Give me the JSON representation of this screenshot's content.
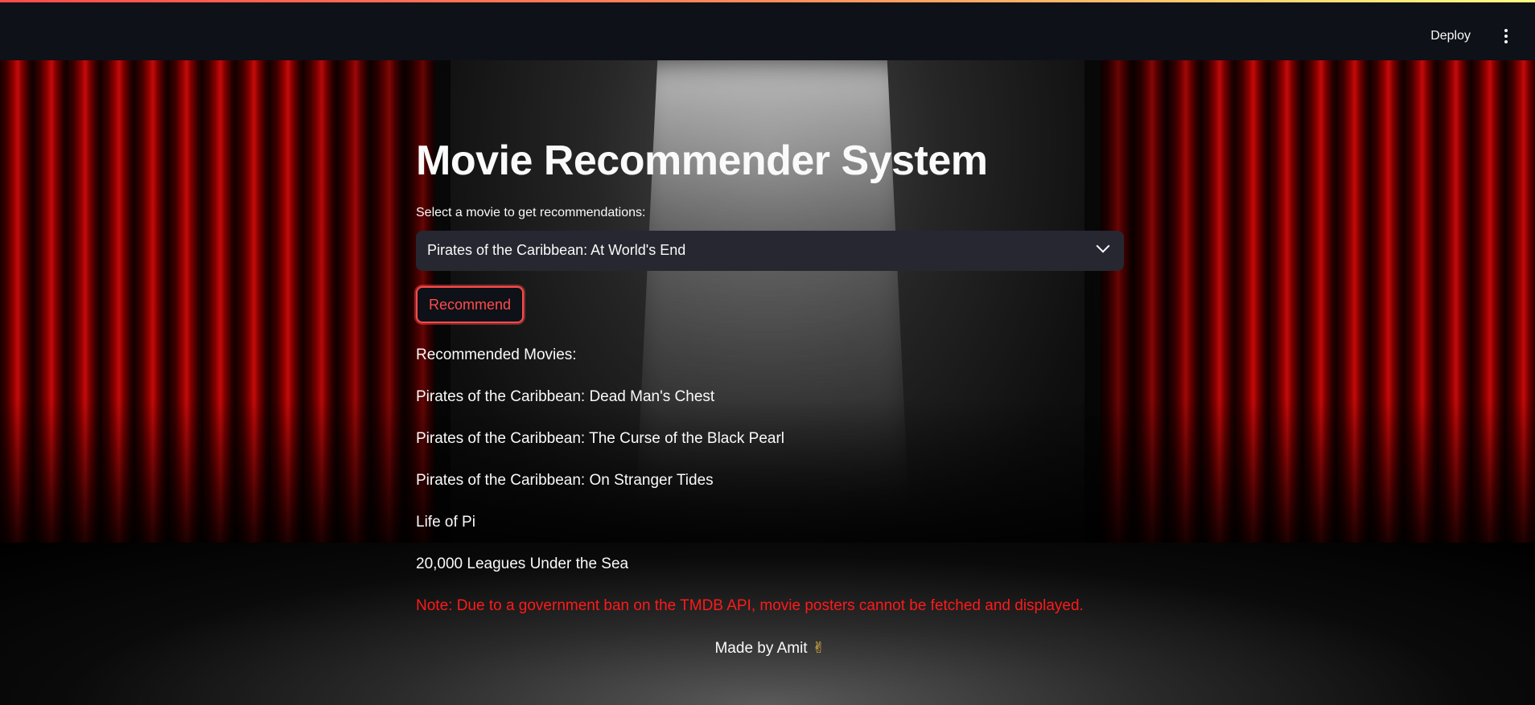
{
  "header": {
    "deploy_label": "Deploy",
    "menu_icon": "kebab-vertical-icon"
  },
  "main": {
    "title": "Movie Recommender System",
    "select": {
      "label": "Select a movie to get recommendations:",
      "value": "Pirates of the Caribbean: At World's End"
    },
    "recommend_label": "Recommend",
    "results_heading": "Recommended Movies:",
    "recommendations": [
      "Pirates of the Caribbean: Dead Man's Chest",
      "Pirates of the Caribbean: The Curse of the Black Pearl",
      "Pirates of the Caribbean: On Stranger Tides",
      "Life of Pi",
      "20,000 Leagues Under the Sea"
    ],
    "note": "Note: Due to a government ban on the TMDB API, movie posters cannot be fetched and displayed.",
    "footer": "Made by Amit",
    "footer_icon": "✌"
  },
  "colors": {
    "accent": "#ff4b4b",
    "note": "#ff1a1a",
    "header_bg": "#0e1117",
    "select_bg": "#262730"
  }
}
